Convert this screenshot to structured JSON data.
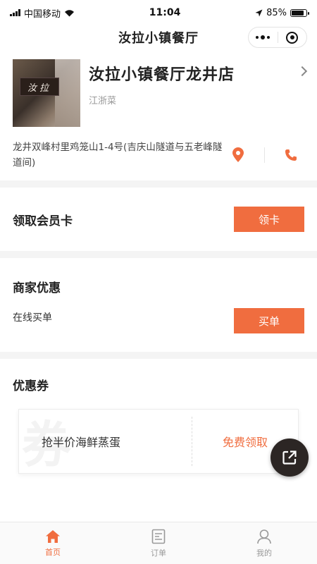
{
  "status_bar": {
    "carrier": "中国移动",
    "time": "11:04",
    "battery_pct": "85%",
    "battery_level": 0.85
  },
  "nav": {
    "title": "汝拉小镇餐厅"
  },
  "store": {
    "image_sign": "汝拉",
    "name": "汝拉小镇餐厅龙井店",
    "cuisine": "江浙菜",
    "address": "龙井双峰村里鸡笼山1-4号(吉庆山隧道与五老峰隧道间)"
  },
  "member": {
    "title": "领取会员卡",
    "button": "领卡"
  },
  "merchant": {
    "title": "商家优惠",
    "item_label": "在线买单",
    "button": "买单"
  },
  "coupons": {
    "title": "优惠券",
    "items": [
      {
        "watermark": "券",
        "name": "抢半价海鲜蒸蛋",
        "action": "免费领取"
      }
    ]
  },
  "tabs": [
    {
      "label": "首页"
    },
    {
      "label": "订单"
    },
    {
      "label": "我的"
    }
  ],
  "colors": {
    "accent": "#f06d3f",
    "text": "#222222",
    "muted": "#999999"
  }
}
